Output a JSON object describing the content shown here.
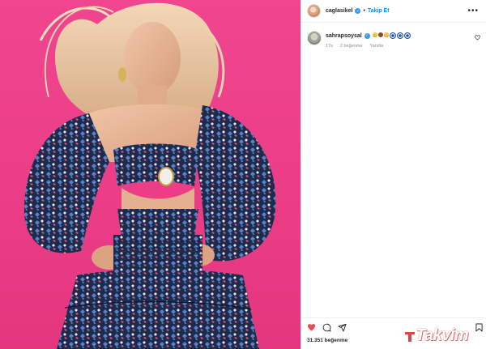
{
  "post": {
    "author": "caglasikel",
    "follow_label": "Takip Et",
    "dot": "•",
    "more_label": "•••"
  },
  "comment": {
    "author": "sahrapsoysal",
    "emojis": [
      "laugh",
      "cake",
      "laugh",
      "eye",
      "eye",
      "eye"
    ],
    "time": "17s",
    "likes": "2 beğenme",
    "reply_label": "Yanıtla"
  },
  "likes_text": "31.351 beğenme",
  "watermark": "Takvim",
  "colors": {
    "photo_bg": "#eb3d86",
    "verified": "#3897f0",
    "follow": "#0095f6",
    "liked_heart": "#ed4956"
  },
  "icons": [
    "heart-filled-icon",
    "comment-icon",
    "share-icon",
    "bookmark-icon",
    "verified-icon",
    "more-icon"
  ]
}
